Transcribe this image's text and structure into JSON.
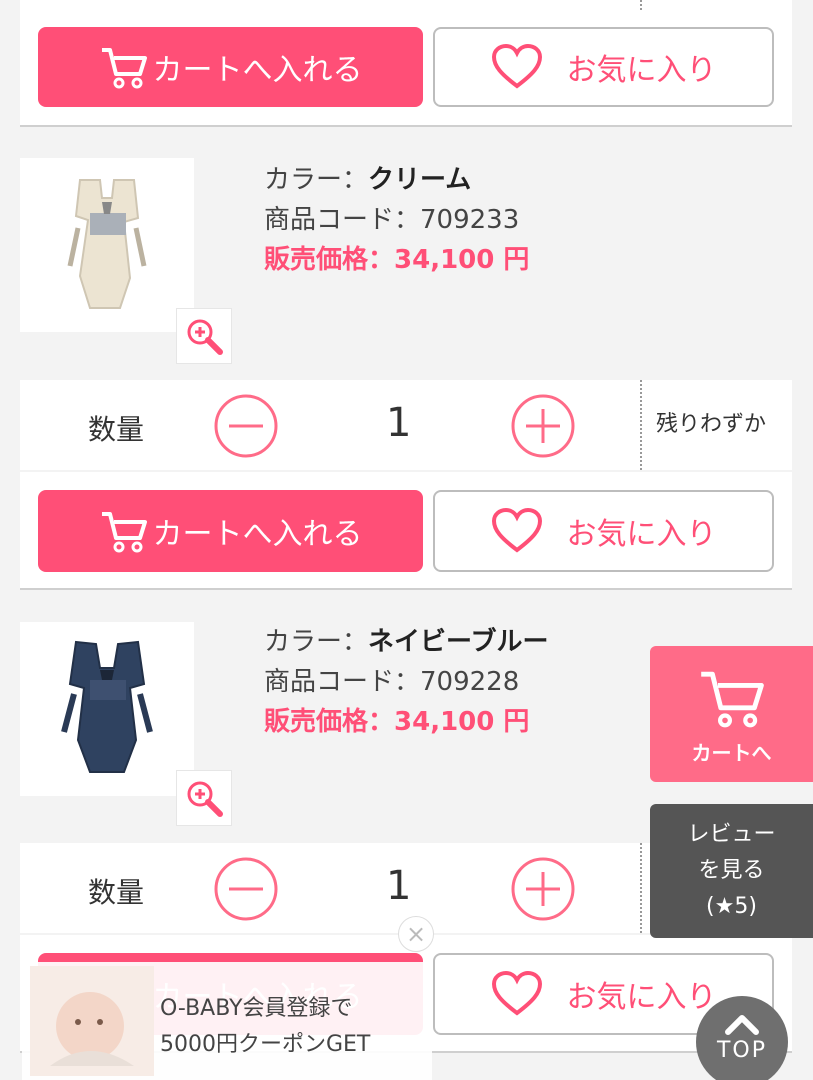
{
  "buttons": {
    "cart_label": "カートへ入れる",
    "favorite_label": "お気に入り"
  },
  "products": [
    {
      "color_label": "カラー：",
      "color_value": "クリーム",
      "code_label": "商品コード：",
      "code_value": "709233",
      "price_label": "販売価格：",
      "price_value": "34,100 円",
      "qty_label": "数量",
      "qty_value": "1",
      "stock": "残りわずか"
    },
    {
      "color_label": "カラー：",
      "color_value": "ネイビーブルー",
      "code_label": "商品コード：",
      "code_value": "709228",
      "price_label": "販売価格：",
      "price_value": "34,100 円",
      "qty_label": "数量",
      "qty_value": "1",
      "stock": ""
    }
  ],
  "float": {
    "cart_label": "カートへ",
    "review_line1": "レビュー",
    "review_line2": "を見る",
    "review_line3": "(★5)",
    "top_label": "TOP"
  },
  "banner": {
    "line1": "O-BABY会員登録で",
    "line2": "5000円クーポンGET",
    "close": "×"
  },
  "colors": {
    "accent": "#ff4f77",
    "background": "#f3f3f3"
  }
}
